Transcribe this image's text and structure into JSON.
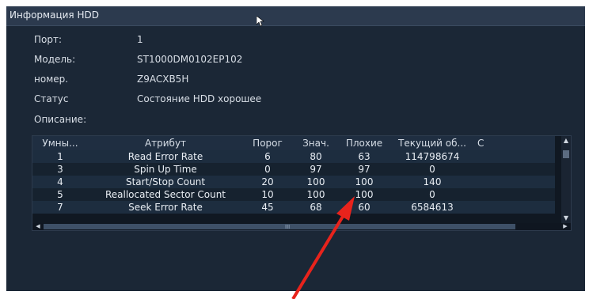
{
  "window": {
    "title": "Информация HDD"
  },
  "info": {
    "port_label": "Порт:",
    "port_value": "1",
    "model_label": "Модель:",
    "model_value": "ST1000DM0102EP102",
    "serial_label": "номер.",
    "serial_value": "Z9ACXB5H",
    "status_label": "Статус",
    "status_value": "Состояние HDD хорошее",
    "description_label": "Описание:"
  },
  "smart_table": {
    "columns": [
      "Умны...",
      "Атрибут",
      "Порог",
      "Знач.",
      "Плохие",
      "Текущий об...",
      "C"
    ],
    "rows": [
      [
        "1",
        "Read Error Rate",
        "6",
        "80",
        "63",
        "114798674"
      ],
      [
        "3",
        "Spin Up Time",
        "0",
        "97",
        "97",
        "0"
      ],
      [
        "4",
        "Start/Stop Count",
        "20",
        "100",
        "100",
        "140"
      ],
      [
        "5",
        "Reallocated Sector Count",
        "10",
        "100",
        "100",
        "0"
      ],
      [
        "7",
        "Seek Error Rate",
        "45",
        "68",
        "60",
        "6584613"
      ]
    ]
  },
  "scrollbar": {
    "grip": "III"
  },
  "colors": {
    "annotation_arrow": "#e8231c",
    "window_bg": "#1b2736"
  }
}
